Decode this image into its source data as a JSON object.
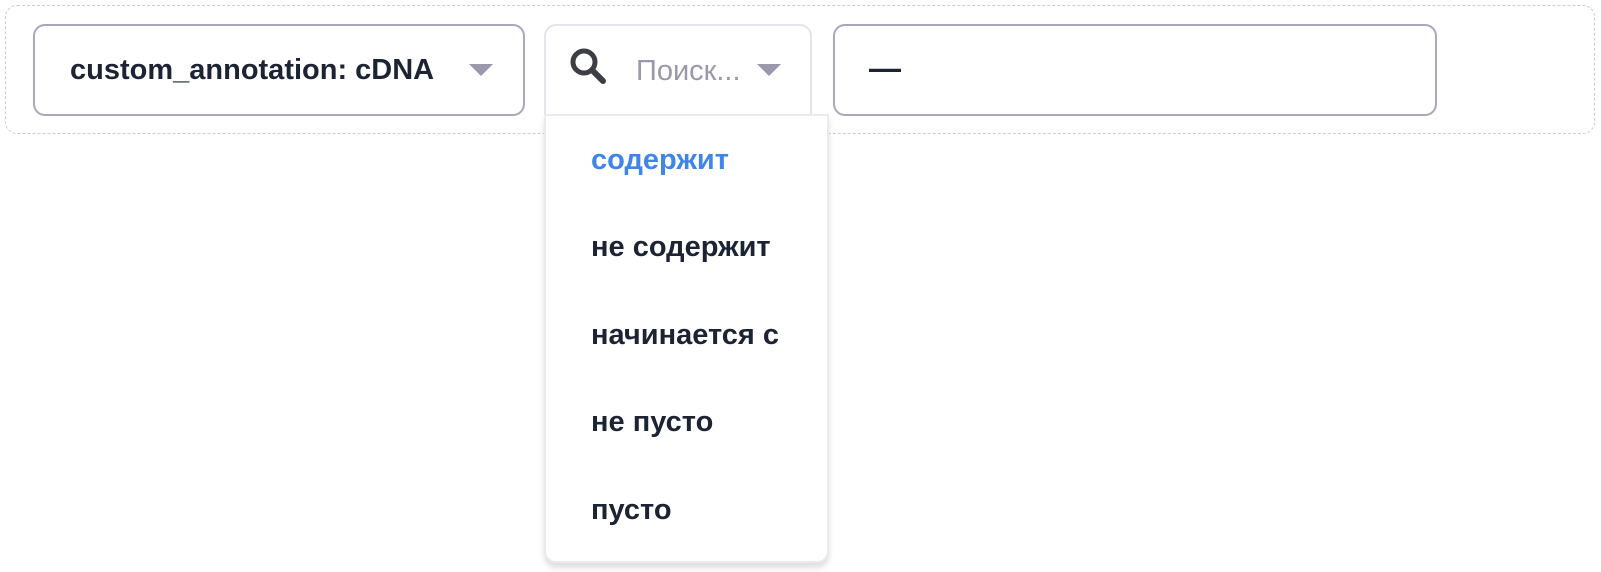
{
  "filter": {
    "field_label": "custom_annotation: cDNA",
    "operator_placeholder": "Поиск...",
    "value_text": "—"
  },
  "dropdown": {
    "options": [
      {
        "label": "содержит",
        "selected": true
      },
      {
        "label": "не содержит",
        "selected": false
      },
      {
        "label": "начинается с",
        "selected": false
      },
      {
        "label": "не пусто",
        "selected": false
      },
      {
        "label": "пусто",
        "selected": false
      }
    ]
  },
  "icons": {
    "search": "search-icon",
    "caret": "chevron-down-icon"
  },
  "colors": {
    "accent": "#3f86e8",
    "text": "#1c2433",
    "muted": "#9a98ab",
    "border": "#a9a7bd"
  }
}
